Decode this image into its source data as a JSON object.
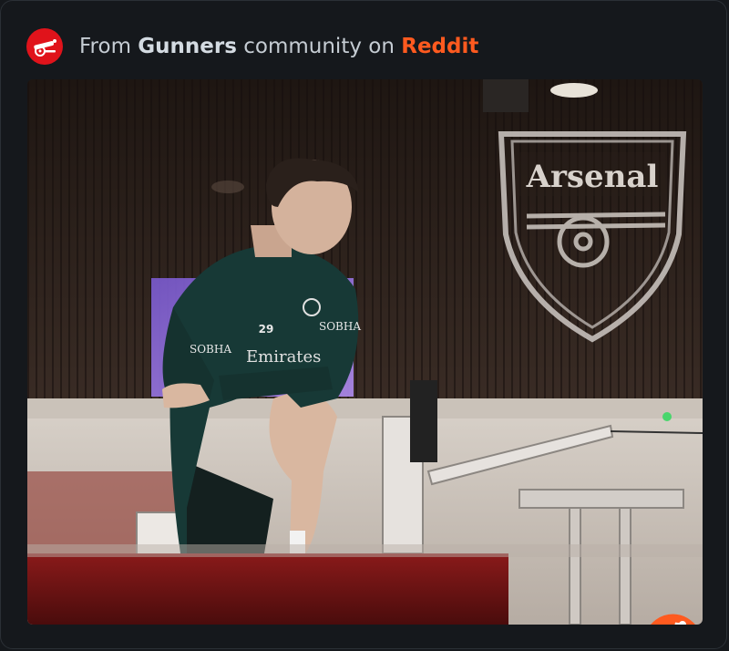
{
  "header": {
    "prefix": "From ",
    "community": "Gunners",
    "middle": " community on ",
    "platform": "Reddit"
  },
  "colors": {
    "background": "#15181c",
    "reddit_orange": "#ff5a1f",
    "community_avatar_red": "#e0131b"
  },
  "media": {
    "wall_crest_text": "Arsenal",
    "shirt_number": "29",
    "shirt_sponsor_left": "SOBHA",
    "shirt_sponsor_right": "SOBHA",
    "shirt_sponsor_main": "Emirates"
  },
  "icons": {
    "community_avatar": "arsenal-cannon-icon",
    "platform_badge": "reddit-snoo-icon"
  }
}
